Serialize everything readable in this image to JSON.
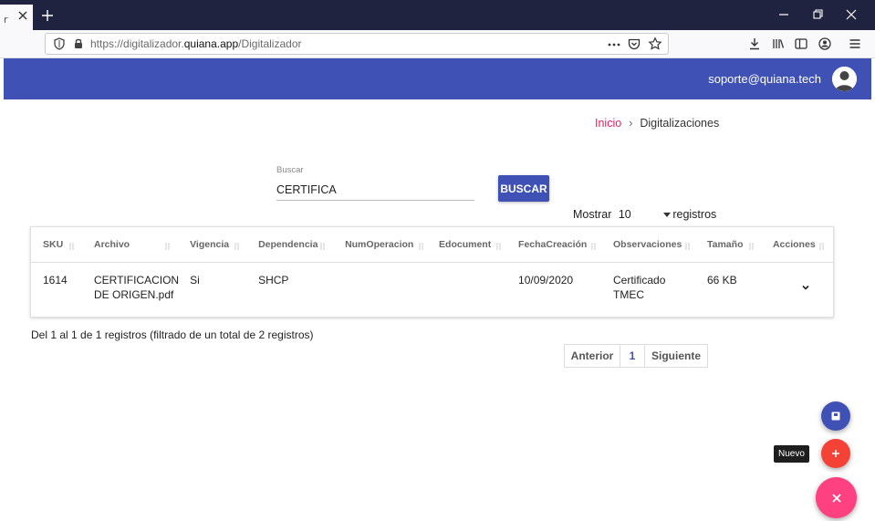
{
  "browser": {
    "tab_stub": "r",
    "url_prefix": "https://digitalizador.",
    "url_domain": "quiana.app",
    "url_path": "/Digitalizador"
  },
  "header": {
    "user_email": "soporte@quiana.tech",
    "brand_color": "#3f51b5"
  },
  "breadcrumb": {
    "home": "Inicio",
    "separator": "›",
    "current": "Digitalizaciones"
  },
  "search": {
    "label": "Buscar",
    "value": "CERTIFICA",
    "button_label": "BUSCAR"
  },
  "length": {
    "prefix": "Mostrar",
    "value": "10",
    "suffix": "registros"
  },
  "table": {
    "columns": [
      "SKU",
      "Archivo",
      "Vigencia",
      "Dependencia",
      "NumOperacion",
      "Edocument",
      "FechaCreación",
      "Observaciones",
      "Tamaño",
      "Acciones"
    ],
    "rows": [
      {
        "sku": "1614",
        "archivo": "CERTIFICACION DE ORIGEN.pdf",
        "vigencia": "Si",
        "dependencia": "SHCP",
        "num_operacion": "",
        "edocument": "",
        "fecha_creacion": "10/09/2020",
        "observaciones": "Certificado TMEC",
        "tamano": "66 KB"
      }
    ]
  },
  "info_text": "Del 1 al 1 de 1 registros (filtrado de un total de 2 registros)",
  "pagination": {
    "previous": "Anterior",
    "current_page": "1",
    "next": "Siguiente"
  },
  "fab": {
    "new_tooltip": "Nuevo"
  },
  "icons": {
    "tab_close": "close-icon",
    "new_tab": "plus-icon",
    "shield": "shield-icon",
    "lock": "lock-icon",
    "more": "more-horizontal-icon",
    "pocket": "pocket-icon",
    "bookmark": "star-icon",
    "download": "download-icon",
    "library": "library-icon",
    "sidebar": "sidebar-icon",
    "account": "account-icon",
    "menu": "hamburger-icon",
    "row_actions": "chevron-down-icon",
    "fab_save": "save-icon",
    "fab_new": "plus-icon",
    "fab_close": "close-icon"
  }
}
